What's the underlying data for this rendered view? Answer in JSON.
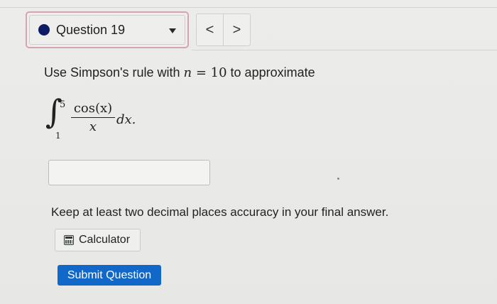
{
  "question_nav": {
    "label": "Question 19",
    "status_color": "#0d1b66",
    "prev_glyph": "<",
    "next_glyph": ">",
    "dropdown_icon": "caret-down-icon"
  },
  "prompt": {
    "text_before": "Use Simpson's rule with ",
    "variable": "n",
    "equals": " = ",
    "value": "10",
    "text_after": " to approximate"
  },
  "integral": {
    "upper_limit": "5",
    "lower_limit": "1",
    "numerator": "cos(x)",
    "denominator": "x",
    "differential": "dx."
  },
  "answer": {
    "value": "",
    "placeholder": ""
  },
  "instruction": "Keep at least two decimal places accuracy in your final answer.",
  "calculator": {
    "label": "Calculator",
    "icon": "calculator-icon"
  },
  "submit": {
    "label": "Submit Question",
    "color": "#1168c8"
  }
}
